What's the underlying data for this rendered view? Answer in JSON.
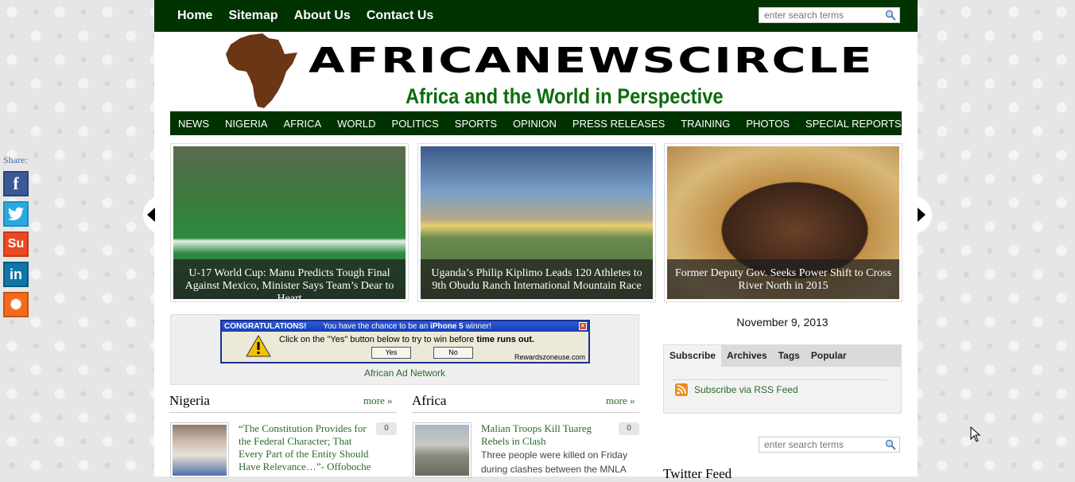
{
  "top_nav": [
    "Home",
    "Sitemap",
    "About Us",
    "Contact Us"
  ],
  "search": {
    "placeholder": "enter search terms"
  },
  "logo": {
    "name": "AFRICANEWSCIRCLE",
    "tagline": "Africa and the World in Perspective"
  },
  "main_nav": [
    "NEWS",
    "NIGERIA",
    "AFRICA",
    "WORLD",
    "POLITICS",
    "SPORTS",
    "OPINION",
    "PRESS RELEASES",
    "TRAINING",
    "PHOTOS",
    "SPECIAL REPORTS"
  ],
  "slides": [
    {
      "caption": "U-17 World Cup: Manu Predicts Tough Final Against Mexico, Minister Says Team’s Dear to Heart"
    },
    {
      "caption": "Uganda’s Philip Kiplimo Leads 120 Athletes to 9th Obudu Ranch International Mountain Race"
    },
    {
      "caption": "Former Deputy Gov. Seeks Power Shift to Cross River North in 2015"
    }
  ],
  "share": {
    "label": "Share:",
    "buttons": [
      "facebook-icon",
      "twitter-icon",
      "stumbleupon-icon",
      "linkedin-icon",
      "more-share-icon"
    ]
  },
  "ad": {
    "header_left": "CONGRATULATIONS!",
    "header_text": "You have the chance to be an ",
    "header_highlight": "iPhone 5",
    "header_end": " winner!",
    "message": "Click on the \"Yes\" button below to try to win before ",
    "message_bold": "time runs out.",
    "yes": "Yes",
    "no": "No",
    "domain": "Rewardszoneuse.com",
    "network": "African Ad Network"
  },
  "sections": [
    {
      "title": "Nigeria",
      "more": "more »",
      "article": {
        "title": "“The Constitution Provides for the Federal Character; That Every Part of the Entity Should Have Relevance…”- Offoboche",
        "excerpt": "",
        "comments": "0"
      }
    },
    {
      "title": "Africa",
      "more": "more »",
      "article": {
        "title": "Malian Troops Kill Tuareg Rebels in Clash",
        "excerpt": "Three people were killed on Friday during clashes between the MNLA",
        "comments": "0"
      }
    }
  ],
  "date": "November 9, 2013",
  "sidebar_tabs": [
    "Subscribe",
    "Archives",
    "Tags",
    "Popular"
  ],
  "rss_label": "Subscribe via RSS Feed",
  "twitter_heading": "Twitter Feed",
  "colors": {
    "nav_green": "#013300",
    "tagline_green": "#0d6b0d",
    "link_green": "#2a6a2a"
  }
}
